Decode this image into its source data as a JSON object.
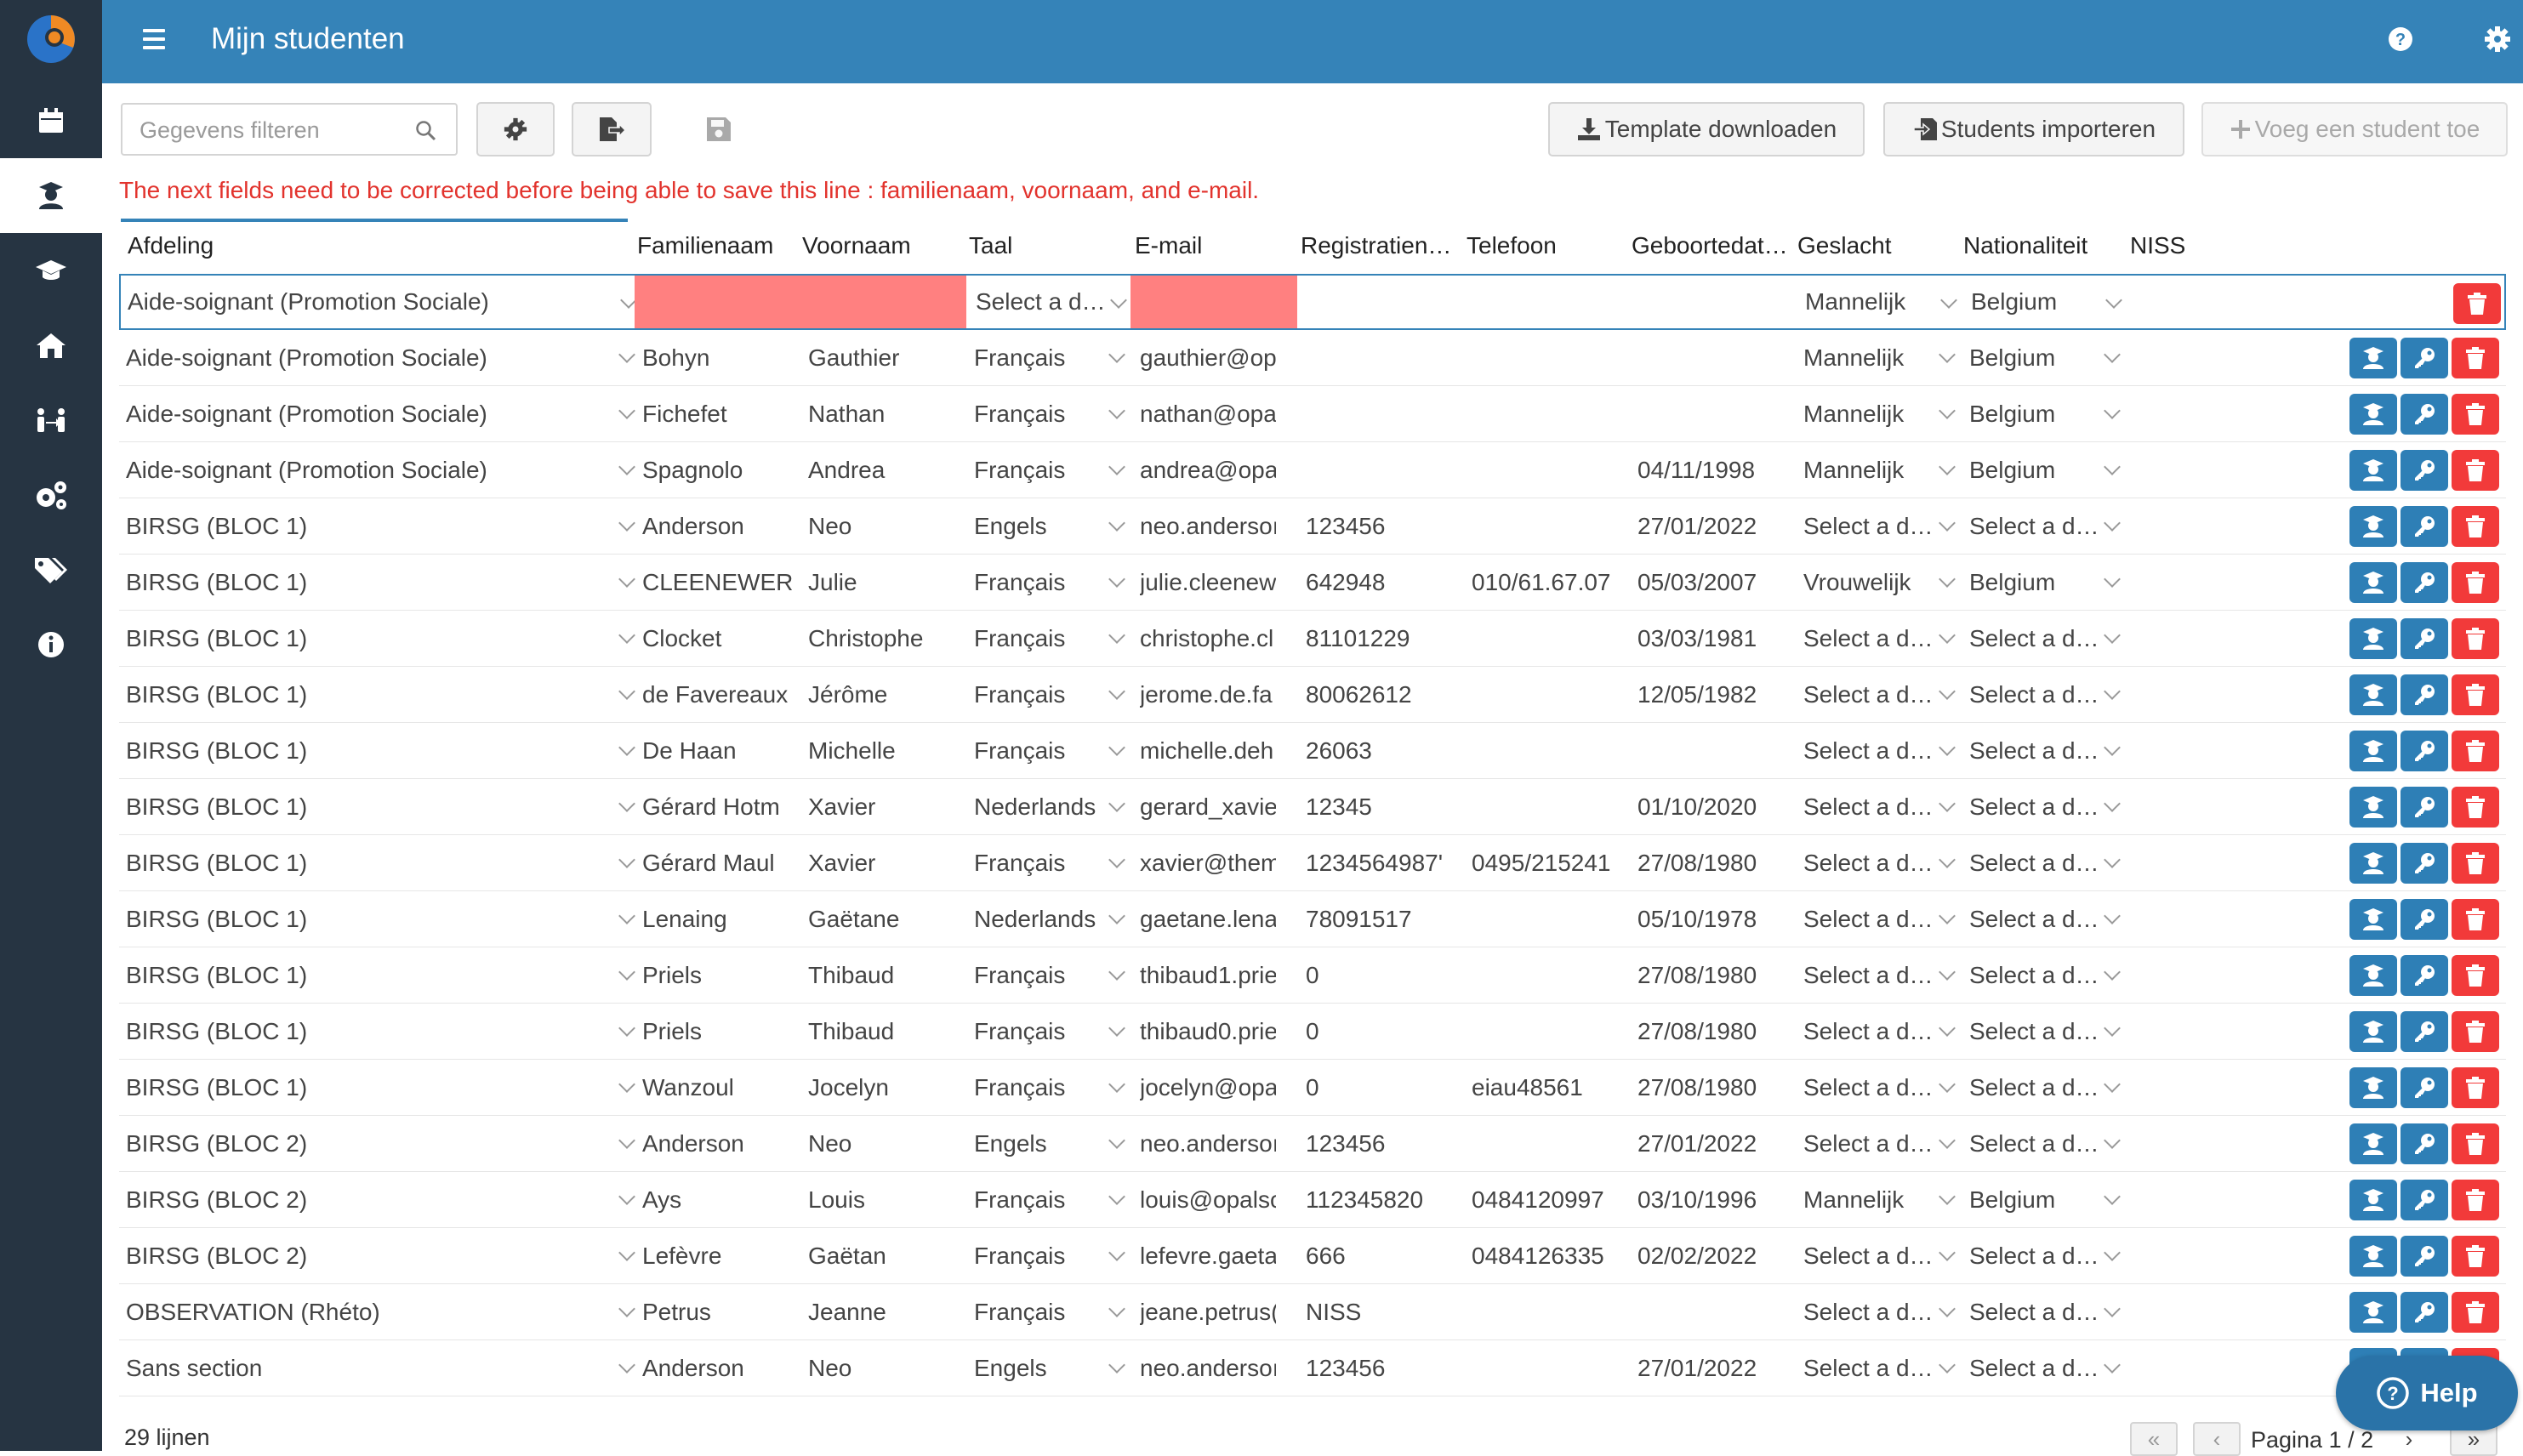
{
  "header": {
    "title": "Mijn studenten"
  },
  "toolbar": {
    "filter_placeholder": "Gegevens filteren",
    "template_label": "Template downloaden",
    "import_label": "Students importeren",
    "add_label": "Voeg een student toe"
  },
  "error_message": "The next fields need to be corrected before being able to save this line : familienaam, voornaam, and e-mail.",
  "columns": [
    "Afdeling",
    "Familienaam",
    "Voornaam",
    "Taal",
    "E-mail",
    "Registratien…",
    "Telefoon",
    "Geboortedat…",
    "Geslacht",
    "Nationaliteit",
    "NISS"
  ],
  "rows": [
    [
      "Aide-soignant (Promotion Sociale)",
      "",
      "",
      "Select a d…",
      "",
      "",
      "",
      "",
      "Mannelijk",
      "Belgium",
      ""
    ],
    [
      "Aide-soignant (Promotion Sociale)",
      "Bohyn",
      "Gauthier",
      "Français",
      "gauthier@op",
      "",
      "",
      "",
      "Mannelijk",
      "Belgium",
      ""
    ],
    [
      "Aide-soignant (Promotion Sociale)",
      "Fichefet",
      "Nathan",
      "Français",
      "nathan@opal",
      "",
      "",
      "",
      "Mannelijk",
      "Belgium",
      ""
    ],
    [
      "Aide-soignant (Promotion Sociale)",
      "Spagnolo",
      "Andrea",
      "Français",
      "andrea@opal",
      "",
      "",
      "04/11/1998",
      "Mannelijk",
      "Belgium",
      ""
    ],
    [
      "BIRSG (BLOC 1)",
      "Anderson",
      "Neo",
      "Engels",
      "neo.andersoı",
      "123456",
      "",
      "27/01/2022",
      "Select a d…",
      "Select a d…",
      ""
    ],
    [
      "BIRSG (BLOC 1)",
      "CLEENEWER",
      "Julie",
      "Français",
      "julie.cleenew",
      "642948",
      "010/61.67.07",
      "05/03/2007",
      "Vrouwelijk",
      "Belgium",
      ""
    ],
    [
      "BIRSG (BLOC 1)",
      "Clocket",
      "Christophe",
      "Français",
      "christophe.cl",
      "81101229",
      "",
      "03/03/1981",
      "Select a d…",
      "Select a d…",
      ""
    ],
    [
      "BIRSG (BLOC 1)",
      "de Favereaux",
      "Jérôme",
      "Français",
      "jerome.de.fa",
      "80062612",
      "",
      "12/05/1982",
      "Select a d…",
      "Select a d…",
      ""
    ],
    [
      "BIRSG (BLOC 1)",
      "De Haan",
      "Michelle",
      "Français",
      "michelle.deh",
      "26063",
      "",
      "",
      "Select a d…",
      "Select a d…",
      ""
    ],
    [
      "BIRSG (BLOC 1)",
      "Gérard Hotm",
      "Xavier",
      "Nederlands",
      "gerard_xavieı",
      "12345",
      "",
      "01/10/2020",
      "Select a d…",
      "Select a d…",
      ""
    ],
    [
      "BIRSG (BLOC 1)",
      "Gérard Maul",
      "Xavier",
      "Français",
      "xavier@them",
      "1234564987'",
      "0495/215241",
      "27/08/1980",
      "Select a d…",
      "Select a d…",
      ""
    ],
    [
      "BIRSG (BLOC 1)",
      "Lenaing",
      "Gaëtane",
      "Nederlands",
      "gaetane.lena",
      "78091517",
      "",
      "05/10/1978",
      "Select a d…",
      "Select a d…",
      ""
    ],
    [
      "BIRSG (BLOC 1)",
      "Priels",
      "Thibaud",
      "Français",
      "thibaud1.prie",
      "0",
      "",
      "27/08/1980",
      "Select a d…",
      "Select a d…",
      ""
    ],
    [
      "BIRSG (BLOC 1)",
      "Priels",
      "Thibaud",
      "Français",
      "thibaud0.prie",
      "0",
      "",
      "27/08/1980",
      "Select a d…",
      "Select a d…",
      ""
    ],
    [
      "BIRSG (BLOC 1)",
      "Wanzoul",
      "Jocelyn",
      "Français",
      "jocelyn@opa",
      "0",
      "eiau48561",
      "27/08/1980",
      "Select a d…",
      "Select a d…",
      ""
    ],
    [
      "BIRSG (BLOC 2)",
      "Anderson",
      "Neo",
      "Engels",
      "neo.andersoı",
      "123456",
      "",
      "27/01/2022",
      "Select a d…",
      "Select a d…",
      ""
    ],
    [
      "BIRSG (BLOC 2)",
      "Ays",
      "Louis",
      "Français",
      "louis@opalsc",
      "112345820",
      "0484120997",
      "03/10/1996",
      "Mannelijk",
      "Belgium",
      ""
    ],
    [
      "BIRSG (BLOC 2)",
      "Lefèvre",
      "Gaëtan",
      "Français",
      "lefevre.gaeta",
      "666",
      "0484126335",
      "02/02/2022",
      "Select a d…",
      "Select a d…",
      ""
    ],
    [
      "OBSERVATION (Rhéto)",
      "Petrus",
      "Jeanne",
      "Français",
      "jeane.petrus(",
      "NISS",
      "",
      "",
      "Select a d…",
      "Select a d…",
      ""
    ],
    [
      "Sans section",
      "Anderson",
      "Neo",
      "Engels",
      "neo.andersoı",
      "123456",
      "",
      "27/01/2022",
      "Select a d…",
      "Select a d…",
      ""
    ]
  ],
  "footer": {
    "count": "29 lijnen",
    "page": "Pagina 1 / 2"
  },
  "help": {
    "label": "Help"
  },
  "colors": {
    "accent": "#3583b8",
    "sidebar": "#263442",
    "danger": "#f23a3a",
    "error_field": "#ff8080"
  }
}
